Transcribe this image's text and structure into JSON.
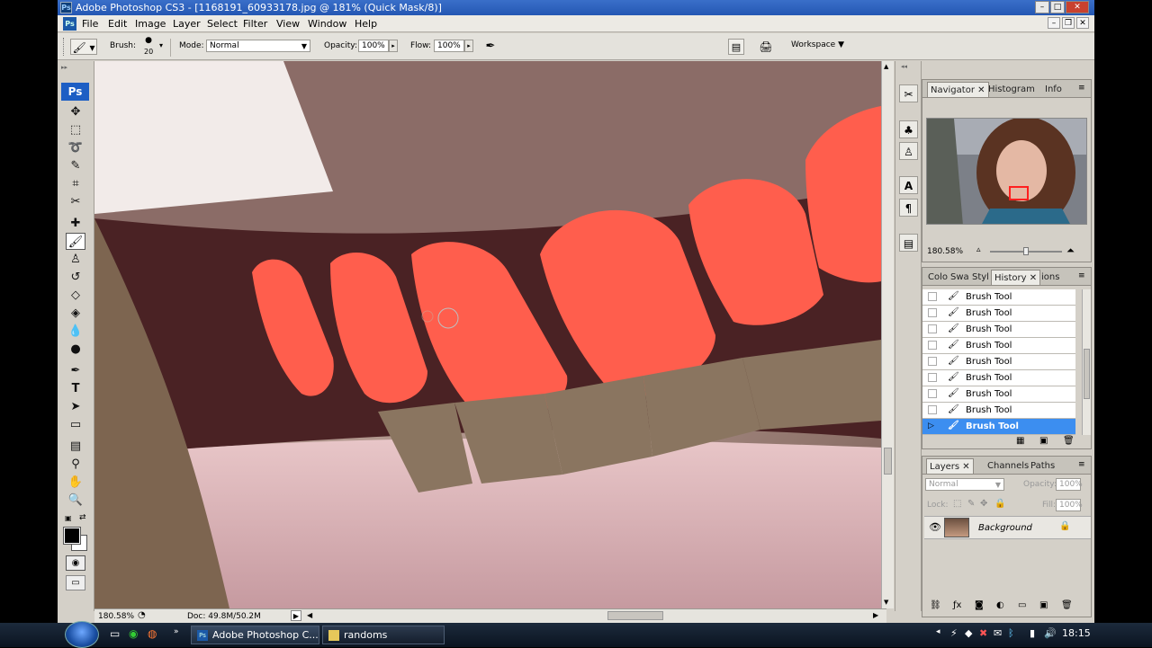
{
  "title_bar": {
    "title": "Adobe Photoshop CS3 - [1168191_60933178.jpg @ 181% (Quick Mask/8)]"
  },
  "menu": [
    "File",
    "Edit",
    "Image",
    "Layer",
    "Select",
    "Filter",
    "View",
    "Window",
    "Help"
  ],
  "options": {
    "brush_label": "Brush:",
    "brush_size": "20",
    "mode_label": "Mode:",
    "mode_value": "Normal",
    "opacity_label": "Opacity:",
    "opacity_value": "100%",
    "flow_label": "Flow:",
    "flow_value": "100%",
    "workspace_label": "Workspace"
  },
  "toolbox": {
    "logo": "Ps"
  },
  "navigator": {
    "tabs": [
      "Navigator",
      "Histogram",
      "Info"
    ],
    "zoom": "180.58%"
  },
  "history": {
    "tabs": [
      "Colo",
      "Swa",
      "Styl",
      "History",
      "ions"
    ],
    "items": [
      "Brush Tool",
      "Brush Tool",
      "Brush Tool",
      "Brush Tool",
      "Brush Tool",
      "Brush Tool",
      "Brush Tool",
      "Brush Tool",
      "Brush Tool"
    ]
  },
  "layers": {
    "tabs": [
      "Layers",
      "Channels",
      "Paths"
    ],
    "blend_mode": "Normal",
    "opacity_label": "Opacity:",
    "opacity_value": "100%",
    "lock_label": "Lock:",
    "fill_label": "Fill:",
    "fill_value": "100%",
    "layer_name": "Background"
  },
  "status_bar": {
    "zoom": "180.58%",
    "doc": "Doc: 49.8M/50.2M"
  },
  "taskbar": {
    "tasks": [
      "Adobe Photoshop C...",
      "randoms"
    ],
    "clock": "18:15"
  }
}
